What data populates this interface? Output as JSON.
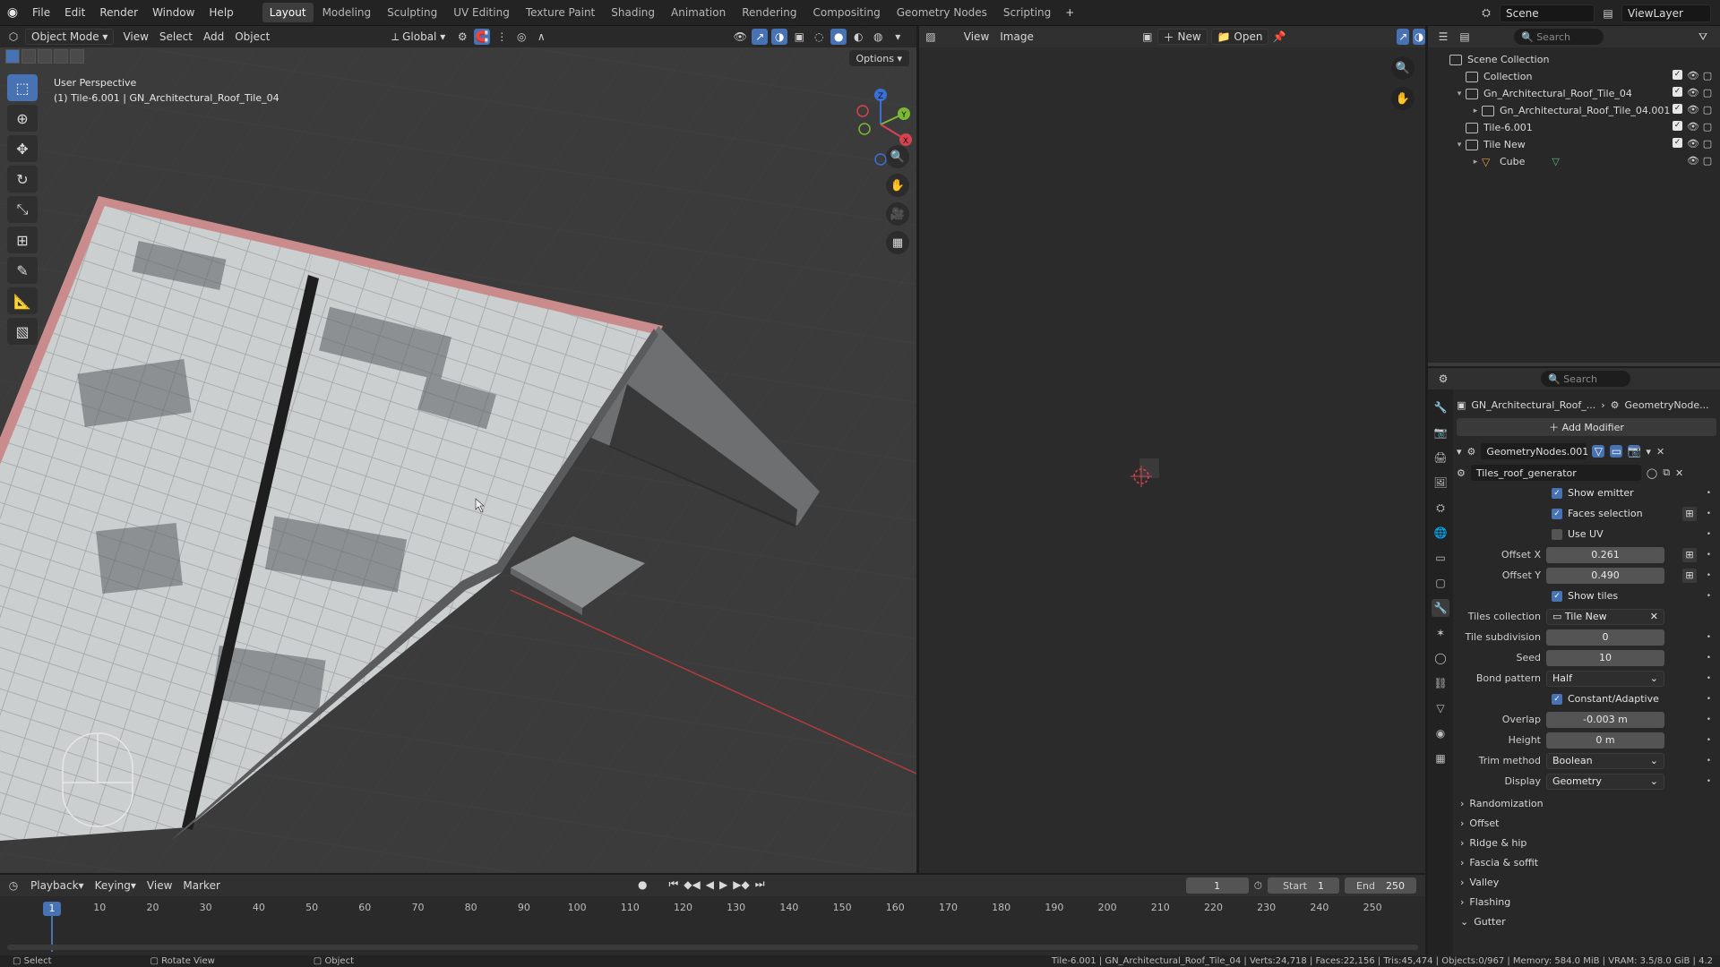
{
  "menu": [
    "File",
    "Edit",
    "Render",
    "Window",
    "Help"
  ],
  "workspaces": [
    {
      "label": "Layout",
      "active": true
    },
    {
      "label": "Modeling"
    },
    {
      "label": "Sculpting"
    },
    {
      "label": "UV Editing"
    },
    {
      "label": "Texture Paint"
    },
    {
      "label": "Shading"
    },
    {
      "label": "Animation"
    },
    {
      "label": "Rendering"
    },
    {
      "label": "Compositing"
    },
    {
      "label": "Geometry Nodes"
    },
    {
      "label": "Scripting"
    }
  ],
  "scene_name": "Scene",
  "view_layer": "ViewLayer",
  "viewport": {
    "mode": "Object Mode",
    "menus": [
      "View",
      "Select",
      "Add",
      "Object"
    ],
    "transform_orientation": "Global",
    "options_label": "Options",
    "info_line1": "User Perspective",
    "info_line2": "(1) Tile-6.001 | GN_Architectural_Roof_Tile_04",
    "gizmo": {
      "x": "X",
      "y": "Y",
      "z": "Z"
    }
  },
  "image_editor": {
    "menus": [
      "View",
      "Image"
    ],
    "new_label": "New",
    "open_label": "Open"
  },
  "outliner": {
    "search_placeholder": "Search",
    "rows": [
      {
        "label": "Scene Collection",
        "depth": 0,
        "expander": "",
        "icon": "collection"
      },
      {
        "label": "Collection",
        "depth": 1,
        "expander": "",
        "icon": "collection"
      },
      {
        "label": "Gn_Architectural_Roof_Tile_04",
        "depth": 1,
        "expander": "▾",
        "icon": "collection"
      },
      {
        "label": "Gn_Architectural_Roof_Tile_04.001",
        "depth": 2,
        "expander": "▸",
        "icon": "collection"
      },
      {
        "label": "Tile-6.001",
        "depth": 1,
        "expander": "",
        "icon": "collection"
      },
      {
        "label": "Tile New",
        "depth": 1,
        "expander": "▾",
        "icon": "collection"
      },
      {
        "label": "Cube",
        "depth": 2,
        "expander": "▸",
        "icon": "mesh"
      }
    ]
  },
  "properties": {
    "search_placeholder": "Search",
    "breadcrumb_object": "GN_Architectural_Roof_...",
    "breadcrumb_modifier": "GeometryNode...",
    "add_modifier_label": "Add Modifier",
    "modifier_name": "GeometryNodes.001",
    "node_group": "Tiles_roof_generator",
    "show_emitter": "Show emitter",
    "faces_selection": "Faces selection",
    "use_uv": "Use UV",
    "offset_x_label": "Offset X",
    "offset_x": "0.261",
    "offset_y_label": "Offset Y",
    "offset_y": "0.490",
    "show_tiles": "Show tiles",
    "tiles_collection_label": "Tiles collection",
    "tiles_collection": "Tile New",
    "tile_subdivision_label": "Tile subdivision",
    "tile_subdivision": "0",
    "seed_label": "Seed",
    "seed": "10",
    "bond_pattern_label": "Bond pattern",
    "bond_pattern": "Half",
    "constant_adaptive": "Constant/Adaptive",
    "overlap_label": "Overlap",
    "overlap": "-0.003 m",
    "height_label": "Height",
    "height": "0 m",
    "trim_method_label": "Trim method",
    "trim_method": "Boolean",
    "display_label": "Display",
    "display": "Geometry",
    "panels": [
      "Randomization",
      "Offset",
      "Ridge & hip",
      "Fascia & soffit",
      "Valley",
      "Flashing",
      "Gutter"
    ]
  },
  "timeline": {
    "menus": [
      "Playback",
      "Keying",
      "View",
      "Marker"
    ],
    "current_frame": "1",
    "current": 1,
    "start_label": "Start",
    "start": "1",
    "end_label": "End",
    "end": "250",
    "ticks": [
      "10",
      "20",
      "30",
      "40",
      "50",
      "60",
      "70",
      "80",
      "90",
      "100",
      "110",
      "120",
      "130",
      "140",
      "150",
      "160",
      "170",
      "180",
      "190",
      "200",
      "210",
      "220",
      "230",
      "240",
      "250"
    ]
  },
  "statusbar": {
    "select": "Select",
    "rotate": "Rotate View",
    "object": "Object",
    "stats": "Tile-6.001 | GN_Architectural_Roof_Tile_04 | Verts:24,718 | Faces:22,156 | Tris:45,474 | Objects:0/967 | Memory: 584.0 MiB | VRAM: 3.5/8.0 GiB | 4.2"
  },
  "colors": {
    "accent": "#4772b3",
    "roof_tile": "#c9cdce",
    "ridge": "#c98b8b"
  }
}
